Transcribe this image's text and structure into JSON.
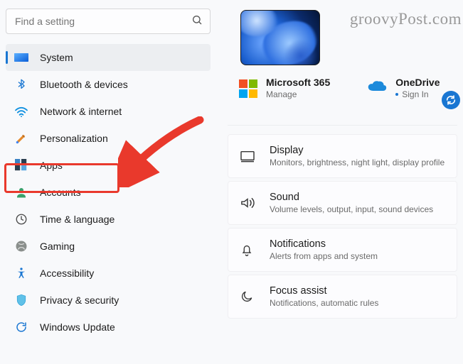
{
  "watermark": "groovyPost.com",
  "search": {
    "placeholder": "Find a setting"
  },
  "sidebar": {
    "items": [
      {
        "label": "System"
      },
      {
        "label": "Bluetooth & devices"
      },
      {
        "label": "Network & internet"
      },
      {
        "label": "Personalization"
      },
      {
        "label": "Apps"
      },
      {
        "label": "Accounts"
      },
      {
        "label": "Time & language"
      },
      {
        "label": "Gaming"
      },
      {
        "label": "Accessibility"
      },
      {
        "label": "Privacy & security"
      },
      {
        "label": "Windows Update"
      }
    ]
  },
  "services": {
    "m365": {
      "title": "Microsoft 365",
      "sub": "Manage"
    },
    "onedrive": {
      "title": "OneDrive",
      "sub": "Sign In"
    }
  },
  "cards": [
    {
      "title": "Display",
      "sub": "Monitors, brightness, night light, display profile"
    },
    {
      "title": "Sound",
      "sub": "Volume levels, output, input, sound devices"
    },
    {
      "title": "Notifications",
      "sub": "Alerts from apps and system"
    },
    {
      "title": "Focus assist",
      "sub": "Notifications, automatic rules"
    }
  ],
  "annotation": {
    "highlighted_item": "Apps",
    "arrow_color": "#e9392c"
  }
}
